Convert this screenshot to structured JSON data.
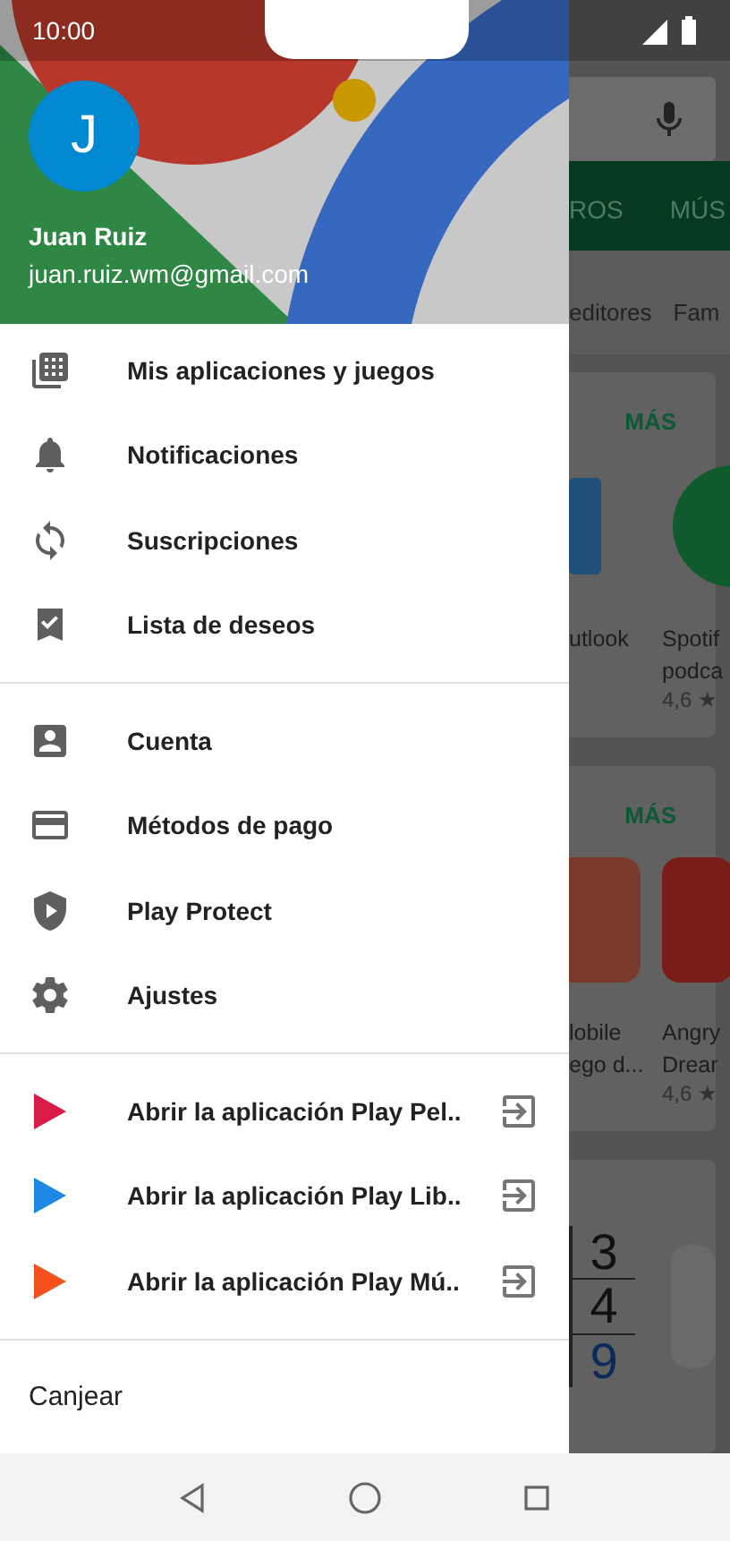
{
  "status_bar": {
    "time": "10:00"
  },
  "drawer": {
    "account": {
      "initial": "J",
      "name": "Juan Ruiz",
      "email": "juan.ruiz.wm@gmail.com"
    },
    "sections": [
      {
        "items": [
          {
            "kind": "menu",
            "label": "Mis aplicaciones y juegos"
          },
          {
            "kind": "menu",
            "label": "Notificaciones"
          },
          {
            "kind": "menu",
            "label": "Suscripciones"
          },
          {
            "kind": "menu",
            "label": "Lista de deseos"
          }
        ]
      },
      {
        "items": [
          {
            "kind": "menu",
            "label": "Cuenta"
          },
          {
            "kind": "menu",
            "label": "Métodos de pago"
          },
          {
            "kind": "menu",
            "label": "Play Protect"
          },
          {
            "kind": "menu",
            "label": "Ajustes"
          }
        ]
      },
      {
        "items": [
          {
            "kind": "app-link",
            "label": "Abrir la aplicación Play Pel.."
          },
          {
            "kind": "app-link",
            "label": "Abrir la aplicación Play Lib.."
          },
          {
            "kind": "app-link",
            "label": "Abrir la aplicación Play Mú.."
          }
        ]
      },
      {
        "items": [
          {
            "kind": "text",
            "label": "Canjear"
          }
        ]
      }
    ]
  },
  "background_app": {
    "tabs": [
      "ROS",
      "MÚS"
    ],
    "chips": [
      "editores",
      "Fam"
    ],
    "cards": [
      {
        "more": "MÁS",
        "apps": [
          {
            "title": [
              "utlook"
            ]
          },
          {
            "title": [
              "Spotif",
              "podca"
            ],
            "rating": "4,6 ★"
          }
        ]
      },
      {
        "more": "MÁS",
        "apps": [
          {
            "title": [
              "lobile",
              "ego d..."
            ]
          },
          {
            "title": [
              "Angry",
              "Drear"
            ],
            "rating": "4,6 ★"
          }
        ]
      }
    ],
    "icon_digits": [
      "3",
      "4",
      "9"
    ]
  }
}
